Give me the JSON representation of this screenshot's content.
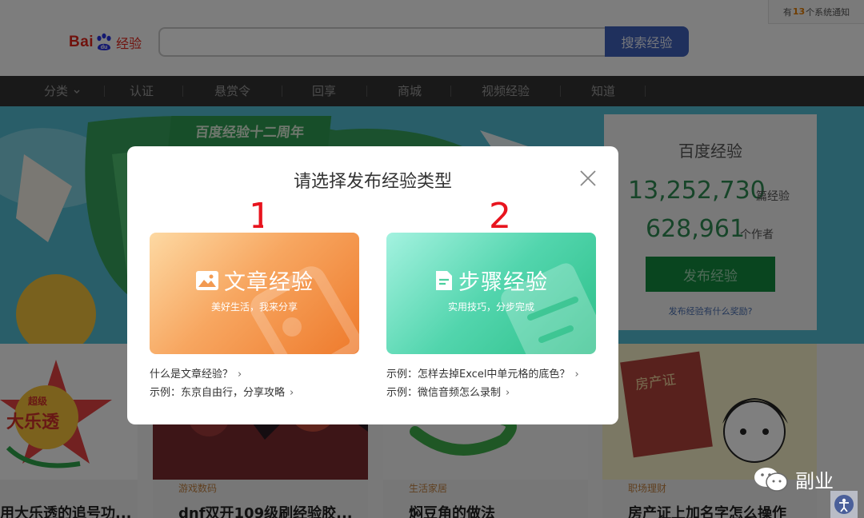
{
  "header": {
    "logo": {
      "bai": "Bai",
      "du": "du",
      "jingyan": "经验"
    },
    "search": {
      "value": "",
      "button": "搜索经验"
    },
    "notice": {
      "prefix": "有",
      "count": "13",
      "suffix": "个系统通知"
    }
  },
  "nav": {
    "items": [
      "分类",
      "认证",
      "悬赏令",
      "回享",
      "商城",
      "视频经验",
      "知道"
    ]
  },
  "banner": {
    "title": "百度经验十二周年"
  },
  "stats": {
    "title": "百度经验",
    "experiences": "13,252,730",
    "experiences_unit": "篇经验",
    "authors": "628,961",
    "authors_unit": "个作者",
    "publish_button": "发布经验",
    "reward_link": "发布经验有什么奖励?"
  },
  "cards": [
    {
      "category": "",
      "title": "用大乐透的追号功..."
    },
    {
      "category": "游戏数码",
      "title": "dnf双开109级刷经验胶..."
    },
    {
      "category": "生活家居",
      "title": "焖豆角的做法"
    },
    {
      "category": "职场理财",
      "title": "房产证上加名字怎么操作"
    }
  ],
  "card_badge": {
    "small": "超级",
    "big": "大乐透"
  },
  "card_stamp": "房产证",
  "modal": {
    "title": "请选择发布经验类型",
    "annotations": [
      "1",
      "2"
    ],
    "article": {
      "title": "文章经验",
      "subtitle": "美好生活，我来分享",
      "links": [
        "什么是文章经验？",
        "示例：东京自由行，分享攻略"
      ]
    },
    "steps": {
      "title": "步骤经验",
      "subtitle": "实用技巧，分步完成",
      "links": [
        "示例：怎样去掉Excel中单元格的底色？",
        "示例：微信音频怎么录制"
      ]
    }
  },
  "watermark": {
    "label": "副业"
  },
  "colors": {
    "accent_blue": "#3f60ba",
    "stat_green": "#2f8a53",
    "publish_green": "#128a3e",
    "article_orange": "#ee7a2c",
    "steps_green": "#2cbf88",
    "annotation_red": "#e8141e"
  },
  "icons": [
    "paw-icon",
    "close-icon",
    "image-icon",
    "document-icon",
    "chevron-right-icon",
    "wechat-icon",
    "accessibility-icon",
    "dropdown-arrow-icon"
  ]
}
